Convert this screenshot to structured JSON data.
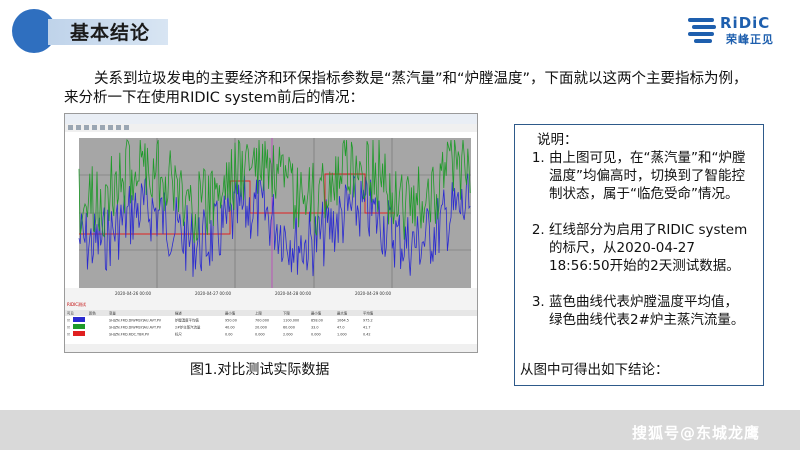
{
  "header": {
    "title": "基本结论",
    "logo_text": "RiDiC",
    "logo_subtext": "荣峰正见"
  },
  "intro": "关系到垃圾发电的主要经济和环保指标参数是“蒸汽量”和“炉膛温度”，下面就以这两个主要指标为例，来分析一下在使用RIDIC system前后的情况：",
  "figure": {
    "caption": "图1.对比测试实际数据",
    "series_colors": {
      "temperature": "#2a2ad0",
      "steam": "#1f9a2a",
      "ruler": "#e02020",
      "marker": "#c040c0"
    },
    "table_headers": [
      "可见",
      "颜色",
      "变量",
      "描述",
      "最小值",
      "上限",
      "下限",
      "最小值",
      "最大值",
      "平均值"
    ],
    "table_rows": [
      [
        "☑",
        "",
        "SHJZN.FRD.DIWMSYJAU.AVT.PV",
        "炉膛温度平均值",
        "950.00",
        "700.000",
        "1100.000",
        "858.00",
        "1064.5",
        "975.2"
      ],
      [
        "☑",
        "",
        "SHJZN.FRD.DIWMSYJAU.AVT.PV",
        "2#炉主蒸汽流量",
        "40.00",
        "20.000",
        "60.000",
        "33.0",
        "47.0",
        "41.7"
      ],
      [
        "☑",
        "",
        "SHJZN.FRD.RDC.TBR.PV",
        "标尺",
        "0.00",
        "0.000",
        "2.000",
        "0.000",
        "1.000",
        "0.42"
      ]
    ]
  },
  "notes": {
    "heading": "说明：",
    "items": [
      "由上图可见，在“蒸汽量”和“炉膛温度”均偏高时，切换到了智能控制状态，属于“临危受命”情况。",
      "红线部分为启用了RIDIC system的标尺，从2020-04-27 18:56:50开始的2天测试数据。",
      "蓝色曲线代表炉膛温度平均值，绿色曲线代表2#炉主蒸汽流量。"
    ],
    "conclusion": "从图中可得出如下结论："
  },
  "watermark": "搜狐号@东城龙鹰"
}
